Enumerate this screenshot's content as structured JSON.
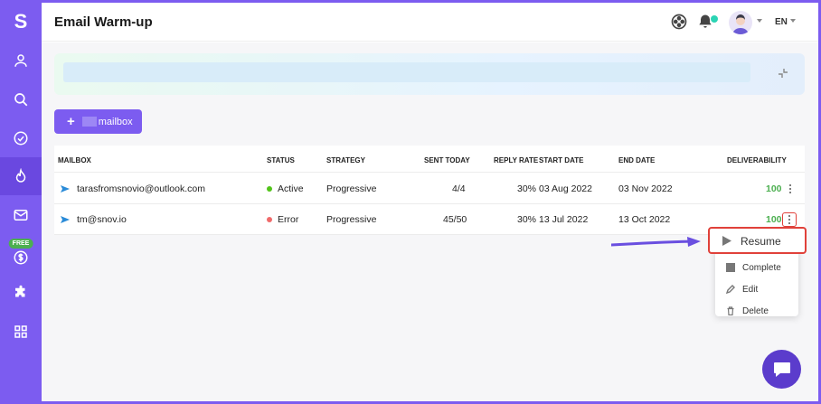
{
  "app": {
    "logo_letter": "S"
  },
  "header": {
    "title": "Email Warm-up",
    "language": "EN"
  },
  "sidebar": {
    "items": [
      {
        "icon": "user-icon"
      },
      {
        "icon": "search-icon"
      },
      {
        "icon": "check-circle-icon"
      },
      {
        "icon": "flame-icon",
        "active": true
      },
      {
        "icon": "mail-icon"
      },
      {
        "icon": "dollar-icon",
        "badge": "FREE"
      },
      {
        "icon": "puzzle-icon"
      },
      {
        "icon": "grid-icon"
      }
    ]
  },
  "toolbar": {
    "add_label": "mailbox"
  },
  "table": {
    "columns": [
      "MAILBOX",
      "STATUS",
      "STRATEGY",
      "SENT TODAY",
      "REPLY RATE",
      "START DATE",
      "END DATE",
      "DELIVERABILITY"
    ],
    "rows": [
      {
        "mailbox": "tarasfromsnovio@outlook.com",
        "status": "Active",
        "status_color": "#52c41a",
        "strategy": "Progressive",
        "sent_today": "4/4",
        "reply_rate": "30%",
        "start_date": "03 Aug 2022",
        "end_date": "03 Nov 2022",
        "deliverability": "100"
      },
      {
        "mailbox": "tm@snov.io",
        "status": "Error",
        "status_color": "#f06a6a",
        "strategy": "Progressive",
        "sent_today": "45/50",
        "reply_rate": "30%",
        "start_date": "13 Jul 2022",
        "end_date": "13 Oct 2022",
        "deliverability": "100"
      }
    ]
  },
  "menu": {
    "resume": "Resume",
    "complete": "Complete",
    "edit": "Edit",
    "delete": "Delete"
  },
  "colors": {
    "brand": "#7c5cf0",
    "highlight": "#e0413a",
    "success": "#4caf50"
  }
}
